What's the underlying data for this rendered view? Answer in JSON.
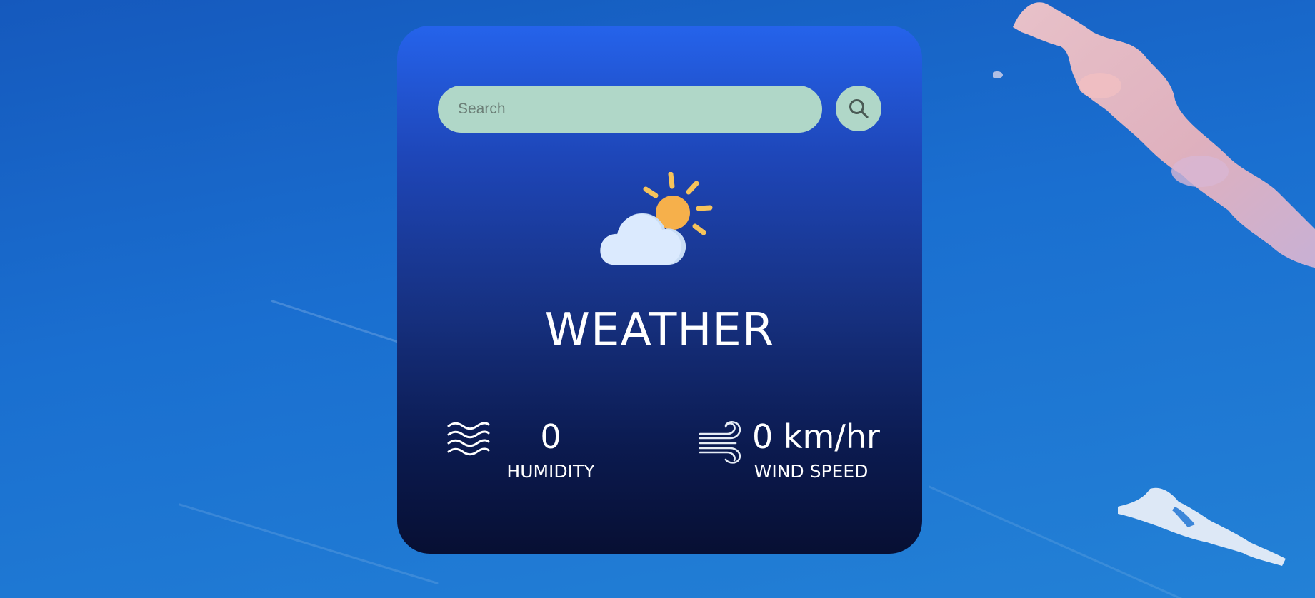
{
  "search": {
    "placeholder": "Search",
    "value": ""
  },
  "weather": {
    "title": "WEATHER",
    "icon": "partly-cloudy-icon"
  },
  "stats": {
    "humidity": {
      "value": "0",
      "label": "HUMIDITY",
      "icon": "humidity-waves-icon"
    },
    "wind": {
      "value": "0 km/hr",
      "label": "WIND SPEED",
      "icon": "wind-icon"
    }
  },
  "colors": {
    "card_top": "#2563eb",
    "card_bottom": "#070f33",
    "search_fill": "#b0d7c8",
    "sun": "#f6b04b",
    "cloud": "#dbeafe"
  }
}
